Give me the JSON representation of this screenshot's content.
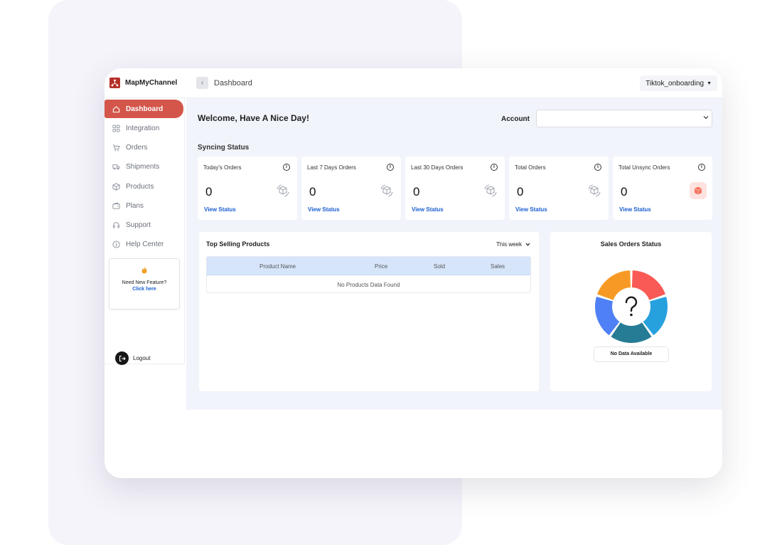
{
  "app": {
    "brand": "MapMyChannel"
  },
  "header": {
    "breadcrumb": "Dashboard",
    "account_dropdown": "Tiktok_onboarding"
  },
  "sidebar": {
    "items": [
      {
        "label": "Dashboard",
        "icon": "home-icon",
        "active": true
      },
      {
        "label": "Integration",
        "icon": "grid-icon"
      },
      {
        "label": "Orders",
        "icon": "cart-icon"
      },
      {
        "label": "Shipments",
        "icon": "truck-icon"
      },
      {
        "label": "Products",
        "icon": "box-icon"
      },
      {
        "label": "Plans",
        "icon": "wallet-icon"
      },
      {
        "label": "Support",
        "icon": "headset-icon"
      },
      {
        "label": "Help Center",
        "icon": "info-icon"
      }
    ],
    "feature": {
      "title": "Need New Feature?",
      "link": "Click here"
    },
    "logout": "Logout"
  },
  "main": {
    "welcome": "Welcome, Have A Nice Day!",
    "account_label": "Account",
    "account_value": "",
    "sync_title": "Syncing Status",
    "cards": [
      {
        "title": "Today's Orders",
        "value": "0",
        "link": "View Status"
      },
      {
        "title": "Last 7 Days Orders",
        "value": "0",
        "link": "View Status"
      },
      {
        "title": "Last 30 Days Orders",
        "value": "0",
        "link": "View Status"
      },
      {
        "title": "Total Orders",
        "value": "0",
        "link": "View Status"
      },
      {
        "title": "Total Unsync Orders",
        "value": "0",
        "link": "View Status"
      }
    ],
    "top_products": {
      "title": "Top Selling Products",
      "period": "This week",
      "columns": [
        "Product Name",
        "Price",
        "Sold",
        "Sales"
      ],
      "empty": "No Products Data Found"
    },
    "sales_status": {
      "title": "Sales Orders Status",
      "empty": "No Data Available",
      "segment_colors": [
        "#fa5a55",
        "#27a1dd",
        "#267b95",
        "#4f80f5",
        "#f79a25"
      ]
    }
  }
}
